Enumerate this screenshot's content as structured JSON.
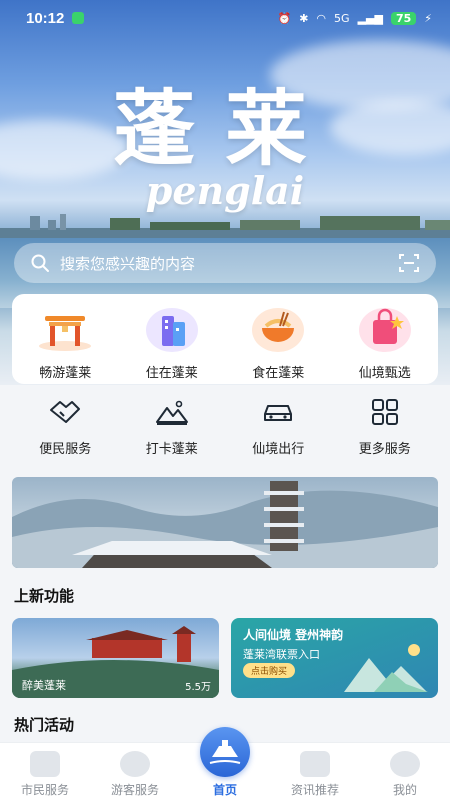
{
  "status_bar": {
    "time": "10:12",
    "network": "5G",
    "battery": "75"
  },
  "hero": {
    "title": "蓬莱",
    "subtitle": "penglai"
  },
  "search": {
    "placeholder": "搜索您感兴趣的内容",
    "search_icon": "search-icon",
    "scan_icon": "scan-icon"
  },
  "features": [
    {
      "label": "畅游蓬莱",
      "icon": "gate-icon"
    },
    {
      "label": "住在蓬莱",
      "icon": "hotel-icon"
    },
    {
      "label": "食在蓬莱",
      "icon": "food-icon"
    },
    {
      "label": "仙境甄选",
      "icon": "shopping-bag-icon"
    }
  ],
  "services": [
    {
      "label": "便民服务",
      "icon": "handshake-icon"
    },
    {
      "label": "打卡蓬莱",
      "icon": "mountain-icon"
    },
    {
      "label": "仙境出行",
      "icon": "car-icon"
    },
    {
      "label": "更多服务",
      "icon": "grid-icon"
    }
  ],
  "sections": {
    "new_features": "上新功能",
    "hot_activities": "热门活动"
  },
  "cards": {
    "card_a": {
      "label": "醉美蓬莱",
      "count": "5.5万"
    },
    "card_b": {
      "title": "人间仙境 登州神韵",
      "subtitle": "蓬莱湾联票入口",
      "button": "点击购买"
    }
  },
  "tabs": [
    {
      "label": "市民服务",
      "active": false
    },
    {
      "label": "游客服务",
      "active": false
    },
    {
      "label": "首页",
      "active": true
    },
    {
      "label": "资讯推荐",
      "active": false
    },
    {
      "label": "我的",
      "active": false
    }
  ],
  "colors": {
    "accent": "#2c6ee0",
    "background": "#f3f5f8"
  }
}
